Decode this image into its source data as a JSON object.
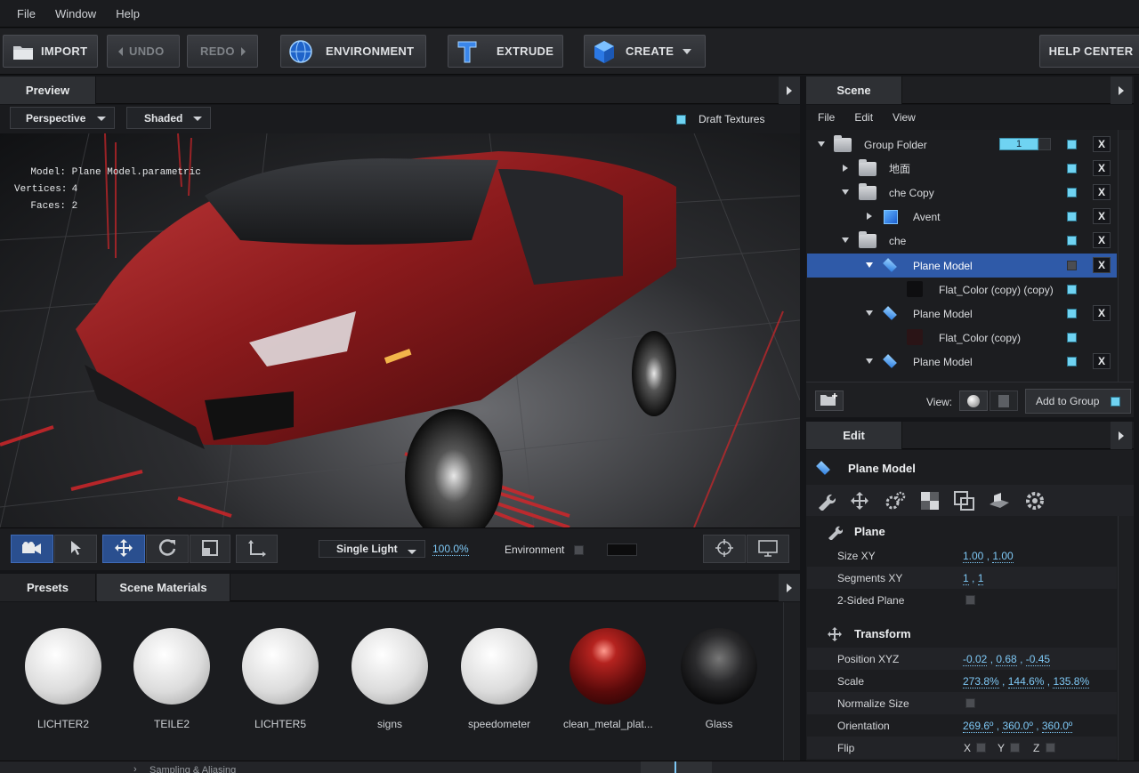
{
  "menu": {
    "file": "File",
    "window": "Window",
    "help": "Help"
  },
  "toolbar": {
    "import": "IMPORT",
    "undo": "UNDO",
    "redo": "REDO",
    "environment": "ENVIRONMENT",
    "extrude": "EXTRUDE",
    "create": "CREATE",
    "help_center": "HELP CENTER"
  },
  "preview": {
    "tab": "Preview",
    "camera_mode": "Perspective",
    "shading_mode": "Shaded",
    "draft_textures": "Draft Textures",
    "info": {
      "model_label": "Model:",
      "model_value": "Plane Model.parametric",
      "vertices_label": "Vertices:",
      "vertices_value": "4",
      "faces_label": "Faces:",
      "faces_value": "2"
    },
    "lighting": "Single Light",
    "light_intensity": "100.0%",
    "environment_label": "Environment"
  },
  "scene": {
    "tab": "Scene",
    "menu": {
      "file": "File",
      "edit": "Edit",
      "view": "View"
    },
    "group_count": "1",
    "items": [
      {
        "label": "Group Folder"
      },
      {
        "label": "地面"
      },
      {
        "label": "che Copy"
      },
      {
        "label": "Avent"
      },
      {
        "label": "che"
      },
      {
        "label": "Plane Model"
      },
      {
        "label": "Flat_Color (copy) (copy)"
      },
      {
        "label": "Plane Model"
      },
      {
        "label": "Flat_Color (copy)"
      },
      {
        "label": "Plane Model"
      }
    ],
    "view_label": "View:",
    "add_to_group": "Add to Group"
  },
  "edit": {
    "tab": "Edit",
    "object_name": "Plane Model",
    "plane_section": "Plane",
    "size_label": "Size XY",
    "size_x": "1.00",
    "size_y": "1.00",
    "segments_label": "Segments XY",
    "seg_x": "1",
    "seg_y": "1",
    "two_sided_label": "2-Sided Plane",
    "transform_section": "Transform",
    "position_label": "Position XYZ",
    "pos_x": "-0.02",
    "pos_y": "0.68",
    "pos_z": "-0.45",
    "scale_label": "Scale",
    "scale_x": "273.8%",
    "scale_y": "144.6%",
    "scale_z": "135.8%",
    "normalize_label": "Normalize Size",
    "orientation_label": "Orientation",
    "ori_x": "269.6º",
    "ori_y": "360.0º",
    "ori_z": "360.0º",
    "flip_label": "Flip",
    "flip_x": "X",
    "flip_y": "Y",
    "flip_z": "Z"
  },
  "materials": {
    "tab_presets": "Presets",
    "tab_scene": "Scene Materials",
    "items": [
      {
        "name": "LICHTER2"
      },
      {
        "name": "TEILE2"
      },
      {
        "name": "LICHTER5"
      },
      {
        "name": "signs"
      },
      {
        "name": "speedometer"
      },
      {
        "name": "clean_metal_plat..."
      },
      {
        "name": "Glass"
      }
    ],
    "status": "Sampling & Aliasing"
  },
  "colors": {
    "accent": "#2f5aa8",
    "checkbox": "#6fd3f2",
    "value_text": "#7ec8f5",
    "car_red": "#8a1a1c"
  }
}
